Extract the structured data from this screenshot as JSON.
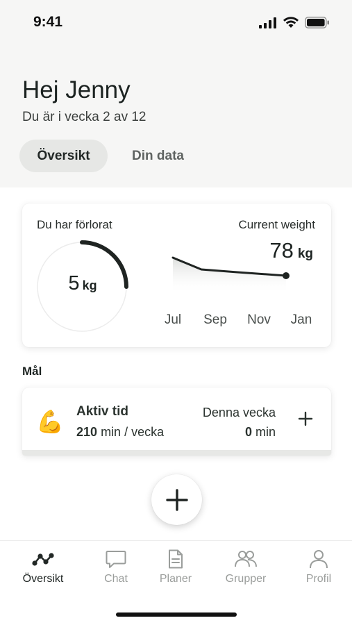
{
  "status": {
    "time": "9:41"
  },
  "header": {
    "greeting": "Hej Jenny",
    "week_text": "Du är i vecka 2 av 12",
    "tabs": [
      {
        "label": "Översikt",
        "active": true
      },
      {
        "label": "Din data",
        "active": false
      }
    ]
  },
  "weight_card": {
    "lost_label": "Du har förlorat",
    "lost_value": "5",
    "lost_unit": "kg",
    "lost_progress": 0.25,
    "current_label": "Current weight",
    "current_value": "78",
    "current_unit": "kg",
    "months": [
      "Jul",
      "Sep",
      "Nov",
      "Jan"
    ]
  },
  "goals": {
    "heading": "Mål",
    "items": [
      {
        "icon": "flexed-biceps-emoji",
        "emoji": "💪",
        "title": "Aktiv tid",
        "target_value": "210",
        "target_unit": "min / vecka",
        "week_label": "Denna vecka",
        "week_value": "0",
        "week_unit": "min"
      }
    ]
  },
  "nav": {
    "items": [
      {
        "label": "Översikt",
        "icon": "trend-icon",
        "active": true
      },
      {
        "label": "Chat",
        "icon": "chat-icon",
        "active": false
      },
      {
        "label": "Planer",
        "icon": "document-icon",
        "active": false
      },
      {
        "label": "Grupper",
        "icon": "group-icon",
        "active": false
      },
      {
        "label": "Profil",
        "icon": "profile-icon",
        "active": false
      }
    ]
  },
  "colors": {
    "header_background": "#f6f6f5",
    "active_tab": "#e6e7e5",
    "text_primary": "#1c2321",
    "nav_inactive": "#9a9d9b"
  }
}
